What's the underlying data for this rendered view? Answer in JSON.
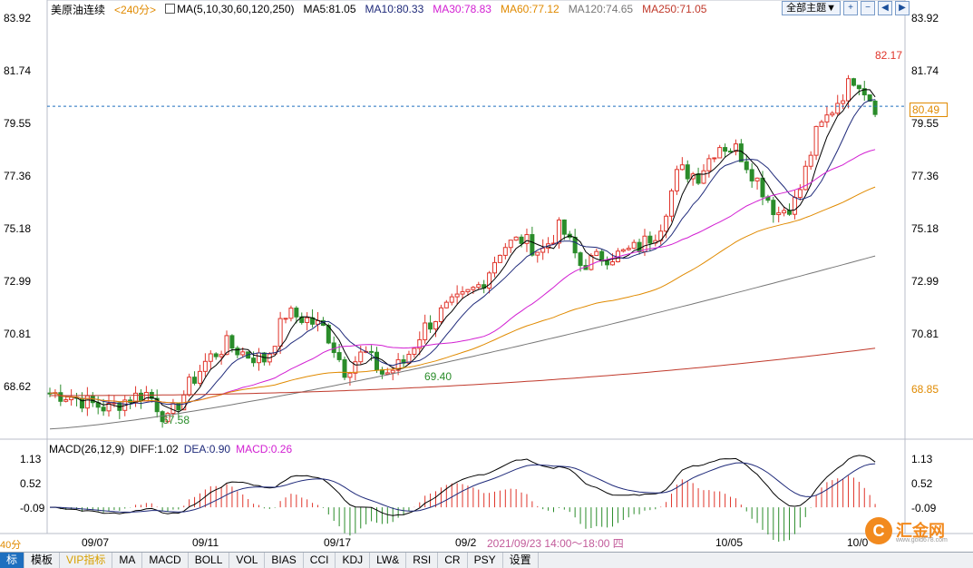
{
  "header": {
    "symbol": "美原油连续",
    "period": "<240分>",
    "ma_params": "MA(5,10,30,60,120,250)",
    "ma5": "MA5:81.05",
    "ma10": "MA10:80.33",
    "ma30": "MA30:78.83",
    "ma60": "MA60:77.12",
    "ma120": "MA120:74.65",
    "ma250": "MA250:71.05"
  },
  "controls": {
    "theme_select": "全部主题▼",
    "zoom_in": "+",
    "zoom_out": "−",
    "scroll_left": "◀",
    "scroll_right": "▶"
  },
  "price_axis": {
    "left": [
      "83.92",
      "81.74",
      "79.55",
      "77.36",
      "75.18",
      "72.99",
      "70.81",
      "68.62"
    ],
    "right": [
      "83.92",
      "81.74",
      "79.55",
      "77.36",
      "75.18",
      "72.99",
      "70.81"
    ],
    "current_price": "80.49",
    "low_marker": "68.85"
  },
  "annotations": {
    "high": "82.17",
    "low1": "67.58",
    "low2": "69.40"
  },
  "macd": {
    "title": "MACD(26,12,9)",
    "diff": "DIFF:1.02",
    "dea": "DEA:0.90",
    "macd": "MACD:0.26",
    "axis": [
      "1.13",
      "0.52",
      "-0.09"
    ]
  },
  "x_axis": {
    "labels": [
      "09/07",
      "09/11",
      "09/17",
      "09/2",
      "10/05",
      "10/0"
    ],
    "crosshair_time": "2021/09/23 14:00～18:00 四",
    "period_label": "40分"
  },
  "tabs": [
    "标",
    "模板",
    "VIP指标",
    "MA",
    "MACD",
    "BOLL",
    "VOL",
    "BIAS",
    "CCI",
    "KDJ",
    "LW&",
    "RSI",
    "CR",
    "PSY",
    "设置"
  ],
  "logo": {
    "name": "汇金网",
    "url": "www.gold678.com"
  },
  "colors": {
    "up": "#e0352b",
    "down": "#2a8c2a",
    "ma5": "#000000",
    "ma10": "#1f2a7a",
    "ma30": "#d21fd2",
    "ma60": "#e08a00",
    "ma120": "#777777",
    "ma250": "#c0392b",
    "accent": "#1e6fbf"
  },
  "chart_data": {
    "type": "candlestick",
    "price_range": [
      67.5,
      84.0
    ],
    "ma_last": {
      "ma5": 81.05,
      "ma10": 80.33,
      "ma30": 78.83,
      "ma60": 77.12,
      "ma120": 74.65,
      "ma250": 71.05
    },
    "close_anchors": [
      69.3,
      69.2,
      68.9,
      68.7,
      69.1,
      69.3,
      68.2,
      69.5,
      70.6,
      71.2,
      70.8,
      70.6,
      72.4,
      72.2,
      71.8,
      70.2,
      70.9,
      70.0,
      70.5,
      71.8,
      72.5,
      73.0,
      73.6,
      75.0,
      75.3,
      74.8,
      75.8,
      74.3,
      74.6,
      74.7,
      75.0,
      75.7,
      78.0,
      77.8,
      79.0,
      78.8,
      77.6,
      76.3,
      76.8,
      79.4,
      80.6,
      81.7,
      80.5
    ],
    "macd_range": [
      -0.55,
      1.25
    ],
    "macd_diff_last": 1.02,
    "macd_dea_last": 0.9
  }
}
